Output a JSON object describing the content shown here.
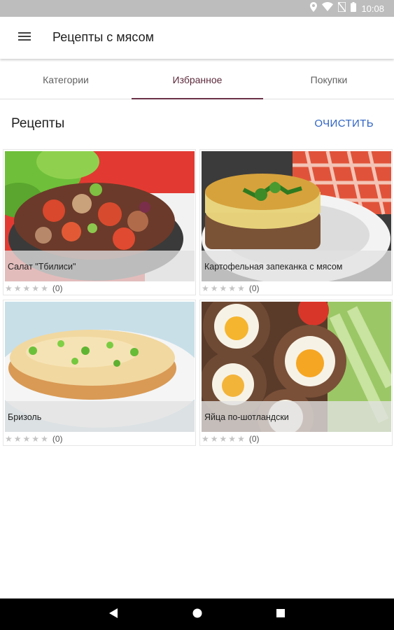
{
  "status_bar": {
    "time": "10:08",
    "icons": [
      "location-icon",
      "wifi-icon",
      "no-sim-icon",
      "battery-icon"
    ]
  },
  "app_bar": {
    "title": "Рецепты с мясом",
    "menu_icon": "hamburger-menu-icon"
  },
  "tabs": [
    {
      "label": "Категории",
      "selected": false
    },
    {
      "label": "Избранное",
      "selected": true
    },
    {
      "label": "Покупки",
      "selected": false
    }
  ],
  "section": {
    "title": "Рецепты",
    "clear_label": "ОЧИСТИТЬ"
  },
  "recipes": [
    {
      "title": "Салат \"Тбилиси\"",
      "rating": 0,
      "rating_count": "(0)"
    },
    {
      "title": "Картофельная запеканка с мясом",
      "rating": 0,
      "rating_count": "(0)"
    },
    {
      "title": "Бризоль",
      "rating": 0,
      "rating_count": "(0)"
    },
    {
      "title": "Яйца по-шотландски",
      "rating": 0,
      "rating_count": "(0)"
    }
  ],
  "colors": {
    "accent": "#6a3147",
    "link": "#2f64c2",
    "status_bar": "#bdbdbd",
    "nav_bar": "#000000"
  },
  "nav_bar": {
    "icons": [
      "back-icon",
      "home-icon",
      "recents-icon"
    ]
  }
}
